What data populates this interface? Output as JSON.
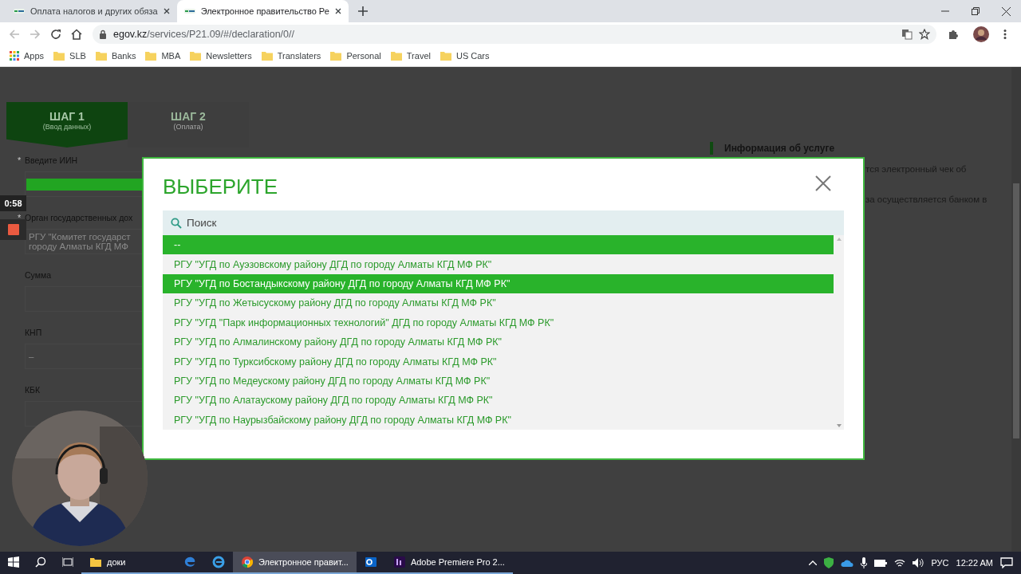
{
  "browser": {
    "tabs": [
      {
        "title": "Оплата налогов и других обяза",
        "selected": false
      },
      {
        "title": "Электронное правительство Ре",
        "selected": true
      }
    ],
    "address": {
      "host": "egov.kz",
      "path": "/services/P21.09/#/declaration/0//"
    },
    "bookmarks": [
      {
        "kind": "apps",
        "label": "Apps"
      },
      {
        "kind": "folder",
        "label": "SLB"
      },
      {
        "kind": "folder",
        "label": "Banks"
      },
      {
        "kind": "folder",
        "label": "MBA"
      },
      {
        "kind": "folder",
        "label": "Newsletters"
      },
      {
        "kind": "folder",
        "label": "Translaters"
      },
      {
        "kind": "folder",
        "label": "Personal"
      },
      {
        "kind": "folder",
        "label": "Travel"
      },
      {
        "kind": "folder",
        "label": "US Cars"
      }
    ]
  },
  "page": {
    "steps": [
      {
        "title": "ШАГ 1",
        "subtitle": "(Ввод данных)",
        "selected": true
      },
      {
        "title": "ШАГ 2",
        "subtitle": "(Оплата)",
        "selected": false
      }
    ],
    "form": [
      {
        "mark": "*",
        "label": "Введите ИИН",
        "kind": "masked"
      },
      {
        "mark": "*",
        "label": "Орган государственных дох",
        "kind": "lines",
        "lines": [
          "РГУ \"Комитет государст",
          "городу Алматы КГД МФ"
        ]
      },
      {
        "label": "Сумма",
        "kind": "empty"
      },
      {
        "label": "КНП",
        "kind": "value",
        "value": "–"
      },
      {
        "label": "КБК",
        "kind": "empty"
      }
    ],
    "info": {
      "title": "Информация об услуге",
      "lines": [
        "тся электронный чек об",
        "за осуществляется банком в"
      ]
    }
  },
  "modal": {
    "title": "ВЫБЕРИТЕ",
    "search": {
      "placeholder": "Поиск"
    },
    "options": [
      {
        "label": "--",
        "selected": true
      },
      {
        "label": "РГУ \"УГД по Ауэзовскому району ДГД по городу Алматы КГД МФ РК\"",
        "selected": false
      },
      {
        "label": "РГУ \"УГД по Бостандыкскому району ДГД по городу Алматы КГД МФ РК\"",
        "selected": true
      },
      {
        "label": "РГУ \"УГД по Жетысускому району ДГД по городу Алматы КГД МФ РК\"",
        "selected": false
      },
      {
        "label": "РГУ \"УГД \"Парк информационных технологий\" ДГД по городу Алматы КГД МФ РК\"",
        "selected": false
      },
      {
        "label": "РГУ \"УГД по Алмалинскому району ДГД по городу Алматы КГД МФ РК\"",
        "selected": false
      },
      {
        "label": "РГУ \"УГД по Турксибскому району ДГД по городу Алматы КГД МФ РК\"",
        "selected": false
      },
      {
        "label": "РГУ \"УГД по Медеускому району ДГД по городу Алматы КГД МФ РК\"",
        "selected": false
      },
      {
        "label": "РГУ \"УГД по Алатаускому району ДГД по городу Алматы КГД МФ РК\"",
        "selected": false
      },
      {
        "label": "РГУ \"УГД по Наурызбайскому району ДГД по городу Алматы КГД МФ РК\"",
        "selected": false
      }
    ]
  },
  "recorder": {
    "time": "0:58"
  },
  "taskbar": {
    "items": [
      {
        "kind": "folder",
        "label": "доки",
        "selected": false
      },
      {
        "kind": "edge",
        "selected": false
      },
      {
        "kind": "ie",
        "selected": false
      },
      {
        "kind": "chrome",
        "label": "Электронное правит...",
        "selected": true
      },
      {
        "kind": "outlook",
        "selected": false
      },
      {
        "kind": "premiere",
        "label": "Adobe Premiere Pro 2...",
        "selected": false
      }
    ],
    "language": "РУС",
    "time": "12:22 AM"
  }
}
